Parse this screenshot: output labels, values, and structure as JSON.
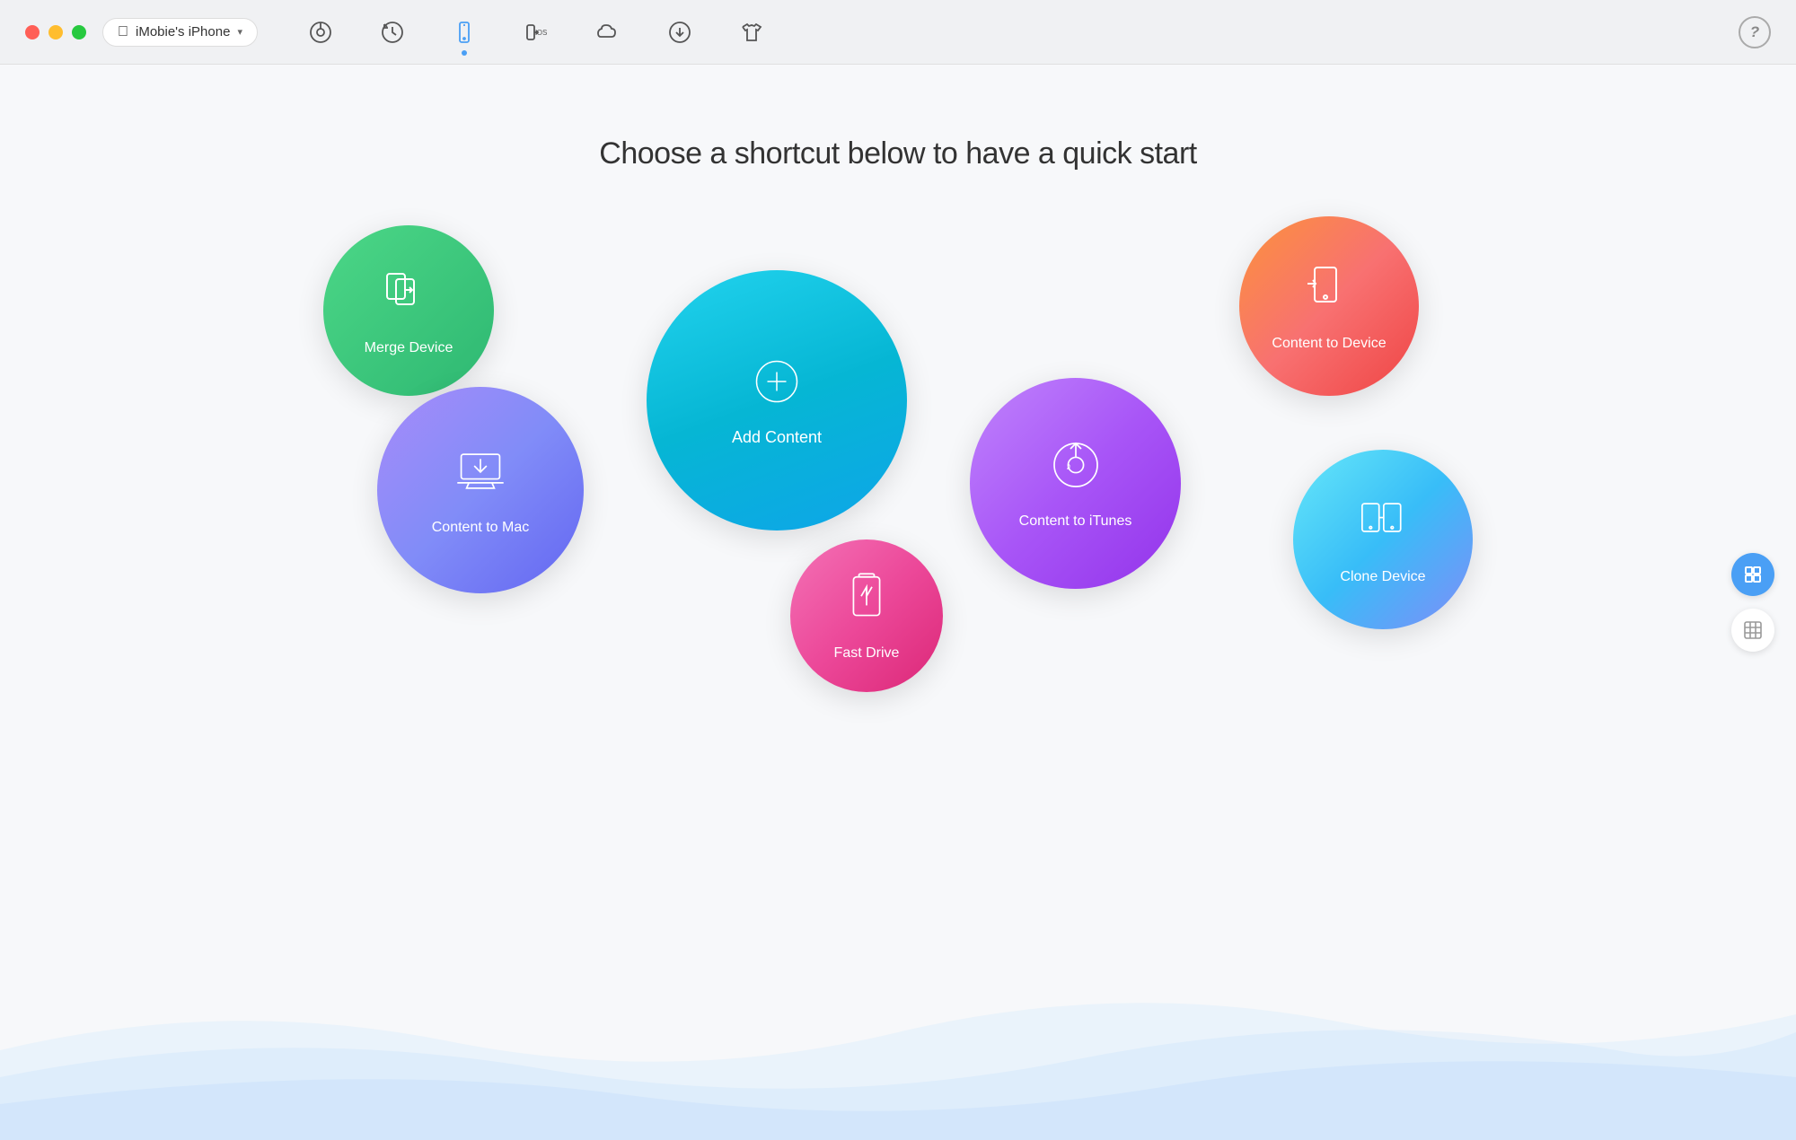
{
  "app": {
    "title": "iMobie's iPhone",
    "device_label": "iMobie's iPhone"
  },
  "titlebar": {
    "device_name": "iMobie's iPhone",
    "help_label": "?"
  },
  "nav": {
    "icons": [
      {
        "name": "music-icon",
        "label": "Music"
      },
      {
        "name": "backup-icon",
        "label": "Backup"
      },
      {
        "name": "device-icon",
        "label": "Device",
        "active": true
      },
      {
        "name": "ios-transfer-icon",
        "label": "iOS Transfer"
      },
      {
        "name": "cloud-icon",
        "label": "Cloud"
      },
      {
        "name": "download-icon",
        "label": "Download"
      },
      {
        "name": "tshirt-icon",
        "label": "Design"
      }
    ]
  },
  "main": {
    "title": "Choose a shortcut below to have a quick start",
    "bubbles": [
      {
        "id": "merge-device",
        "label": "Merge Device",
        "icon": "merge-icon"
      },
      {
        "id": "content-to-mac",
        "label": "Content to Mac",
        "icon": "mac-download-icon"
      },
      {
        "id": "add-content",
        "label": "Add Content",
        "icon": "add-plus-icon"
      },
      {
        "id": "fast-drive",
        "label": "Fast Drive",
        "icon": "battery-icon"
      },
      {
        "id": "content-to-itunes",
        "label": "Content to iTunes",
        "icon": "itunes-icon"
      },
      {
        "id": "content-to-device",
        "label": "Content to Device",
        "icon": "device-transfer-icon"
      },
      {
        "id": "clone-device",
        "label": "Clone Device",
        "icon": "clone-icon"
      }
    ]
  },
  "sidebar": {
    "list_view_label": "List View",
    "grid_view_label": "Grid View"
  }
}
